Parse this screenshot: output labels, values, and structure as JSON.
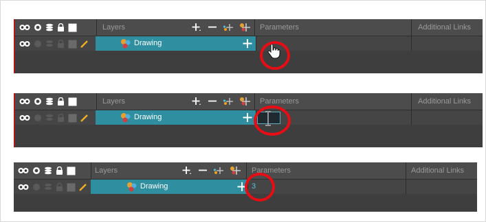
{
  "colors": {
    "panel_bg": "#3e3e3e",
    "header_bg": "#4c4c4c",
    "layer_highlight": "#2f8fa0",
    "value_text": "#4fc3dc",
    "annotation_circle": "#e60d14",
    "error_bar": "#b01818"
  },
  "panels": [
    {
      "header": {
        "layers_label": "Layers",
        "parameters_label": "Parameters",
        "additional_links_label": "Additional Links"
      },
      "header_icons": [
        "eye-icon",
        "solo-icon",
        "stack-icon",
        "lock-icon",
        "color-swatch-icon"
      ],
      "layer_tools": [
        "add-layer-icon",
        "remove-layer-icon",
        "add-peg-icon",
        "add-drawing-icon"
      ],
      "row": {
        "layer_name": "Drawing",
        "layer_icon": "drawing-layer-icon",
        "parameter_state": "hover-pointer",
        "parameter_value": ""
      }
    },
    {
      "header": {
        "layers_label": "Layers",
        "parameters_label": "Parameters",
        "additional_links_label": "Additional Links"
      },
      "header_icons": [
        "eye-icon",
        "solo-icon",
        "stack-icon",
        "lock-icon",
        "color-swatch-icon"
      ],
      "layer_tools": [
        "add-layer-icon",
        "remove-layer-icon",
        "add-peg-icon",
        "add-drawing-icon"
      ],
      "row": {
        "layer_name": "Drawing",
        "layer_icon": "drawing-layer-icon",
        "parameter_state": "text-input",
        "parameter_value": ""
      }
    },
    {
      "header": {
        "layers_label": "Layers",
        "parameters_label": "Parameters",
        "additional_links_label": "Additional Links"
      },
      "header_icons": [
        "eye-icon",
        "solo-icon",
        "stack-icon",
        "lock-icon",
        "color-swatch-icon"
      ],
      "layer_tools": [
        "add-layer-icon",
        "remove-layer-icon",
        "add-peg-icon",
        "add-drawing-icon"
      ],
      "row": {
        "layer_name": "Drawing",
        "layer_icon": "drawing-layer-icon",
        "parameter_state": "value",
        "parameter_value": "3"
      }
    }
  ]
}
